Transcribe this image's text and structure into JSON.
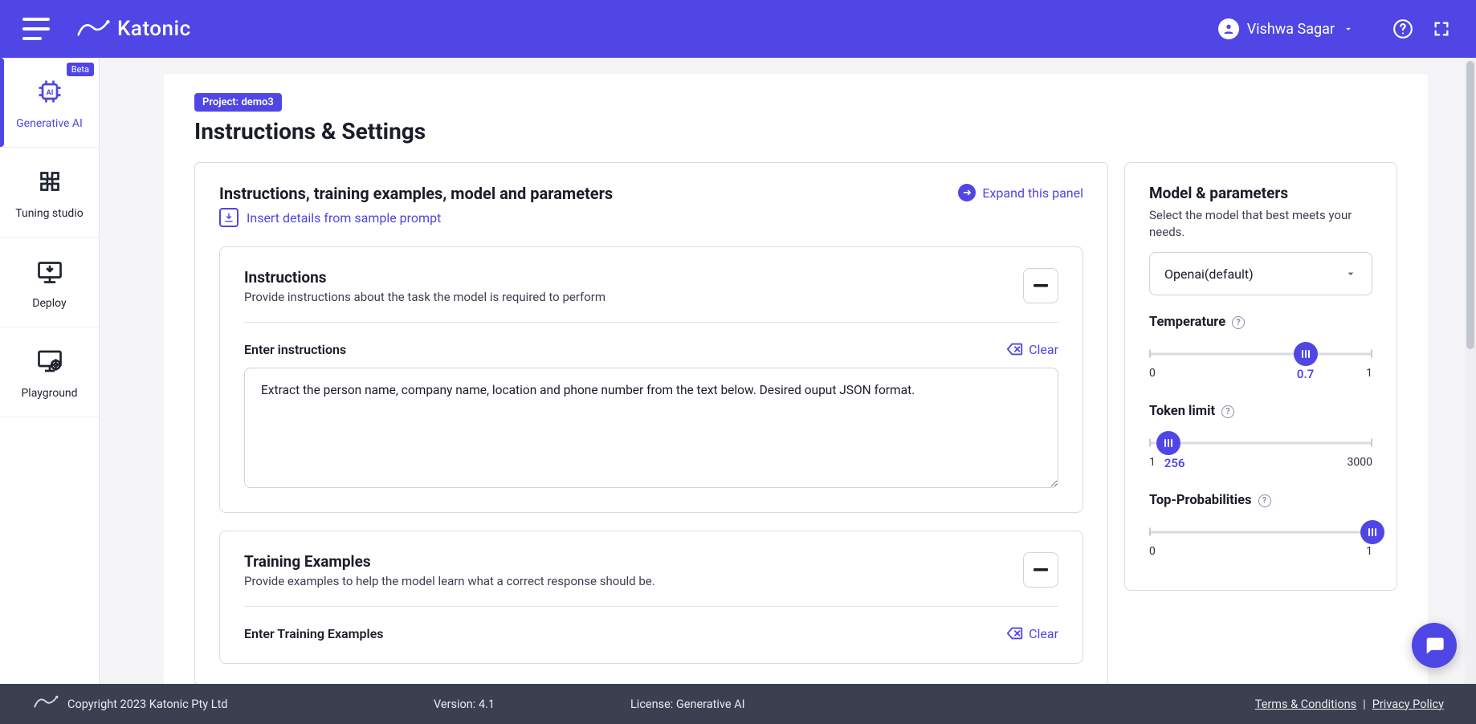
{
  "brand": {
    "name": "Katonic"
  },
  "header": {
    "user_name": "Vishwa Sagar"
  },
  "sidebar": {
    "items": [
      {
        "id": "generative-ai",
        "label": "Generative AI",
        "badge": "Beta",
        "active": true
      },
      {
        "id": "tuning-studio",
        "label": "Tuning studio"
      },
      {
        "id": "deploy",
        "label": "Deploy"
      },
      {
        "id": "playground",
        "label": "Playground"
      }
    ]
  },
  "project": {
    "badge_prefix": "Project:",
    "name": "demo3"
  },
  "page": {
    "title": "Instructions & Settings"
  },
  "left_panel": {
    "title": "Instructions, training examples, model and parameters",
    "expand_label": "Expand this panel",
    "insert_sample_label": "Insert details from sample prompt",
    "instructions": {
      "heading": "Instructions",
      "subheading": "Provide instructions about the task the model is required to perform",
      "field_label": "Enter instructions",
      "clear_label": "Clear",
      "value": "Extract the person name, company name, location and phone number from the text below. Desired ouput JSON format."
    },
    "training": {
      "heading": "Training Examples",
      "subheading": "Provide examples to help the model learn what a correct response should be.",
      "field_label": "Enter Training Examples",
      "clear_label": "Clear"
    }
  },
  "right_panel": {
    "heading": "Model & parameters",
    "subheading": "Select the model that best meets your needs.",
    "model_select": {
      "value": "Openai(default)"
    },
    "temperature": {
      "label": "Temperature",
      "min": "0",
      "max": "1",
      "value": "0.7",
      "pct": 70
    },
    "token_limit": {
      "label": "Token limit",
      "min": "1",
      "max": "3000",
      "value": "256",
      "pct": 8.5
    },
    "top_p": {
      "label": "Top-Probabilities",
      "min": "0",
      "max": "1",
      "value": "1",
      "pct": 100
    }
  },
  "footer": {
    "copyright": "Copyright 2023 Katonic Pty Ltd",
    "version": "Version: 4.1",
    "license": "License: Generative AI",
    "terms": "Terms & Conditions",
    "sep": "|",
    "privacy": "Privacy Policy"
  }
}
